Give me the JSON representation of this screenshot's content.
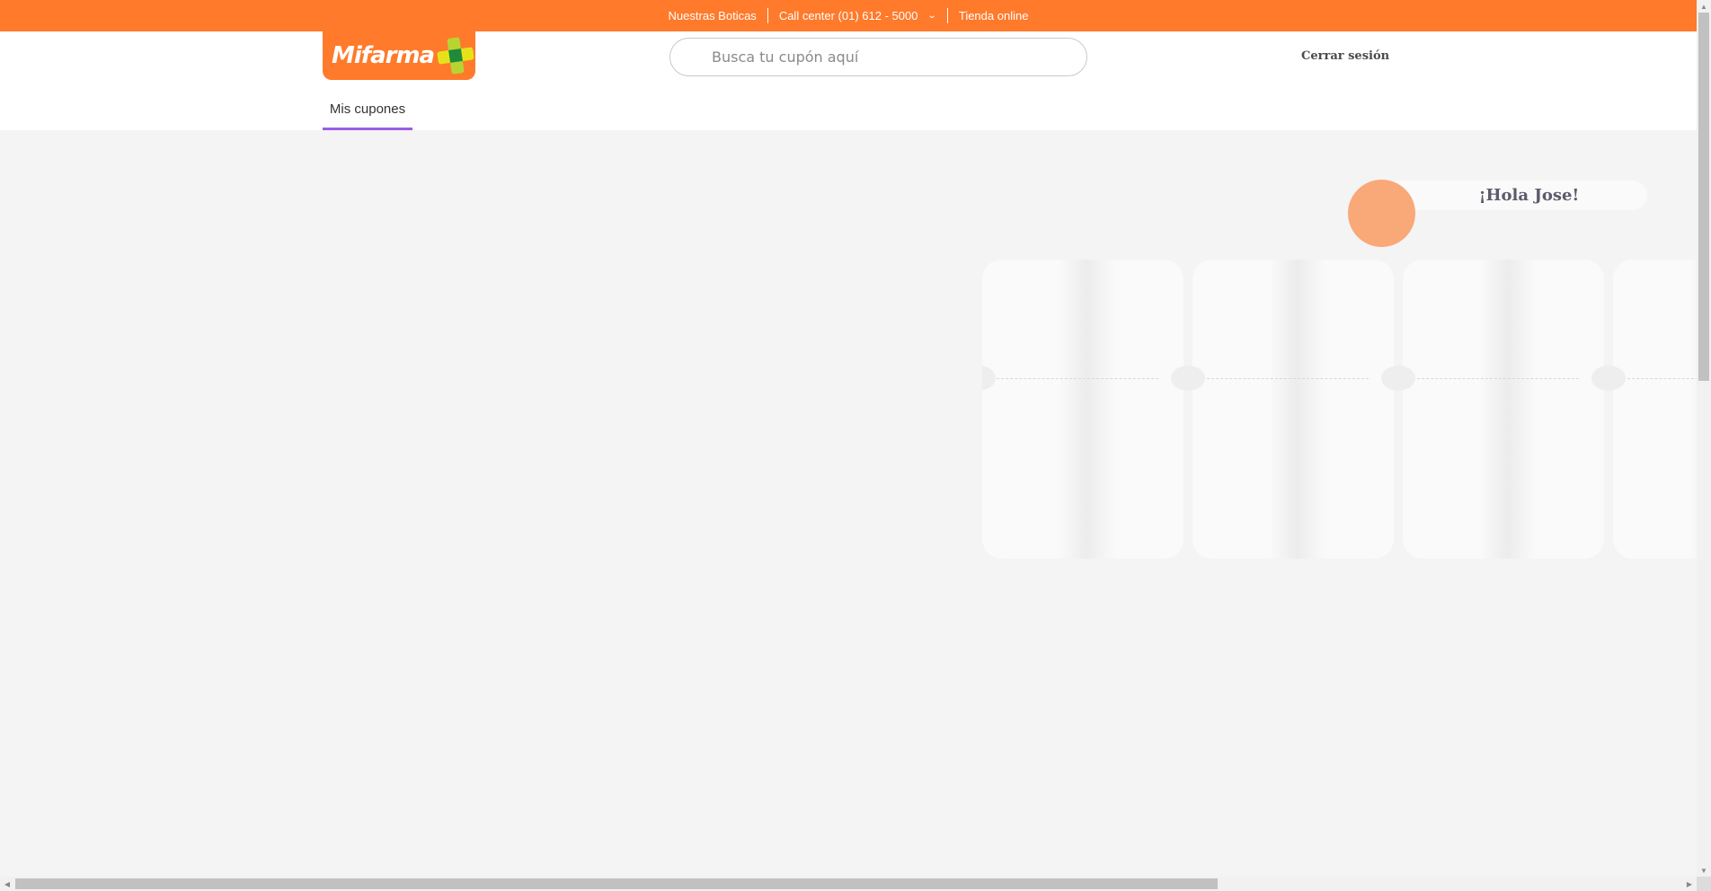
{
  "topbar": {
    "stores_label": "Nuestras Boticas",
    "callcenter_label": "Call center (01) 612 - 5000",
    "callcenter_chevron": "chevron-down-icon",
    "online_store_label": "Tienda online"
  },
  "header": {
    "logo_text": "Mifarma",
    "search_placeholder": "Busca tu cupón aquí",
    "search_value": "",
    "logout_label": "Cerrar sesión",
    "tab_label": "Mis cupones"
  },
  "greeting": {
    "text": "¡Hola Jose!"
  },
  "colors": {
    "brand_orange": "#ff7a2b",
    "tab_underline": "#9b5de5",
    "avatar": "#f9a878",
    "page_background": "#f4f4f4"
  },
  "coupons": {
    "state": "loading",
    "visible_placeholders": 4
  }
}
